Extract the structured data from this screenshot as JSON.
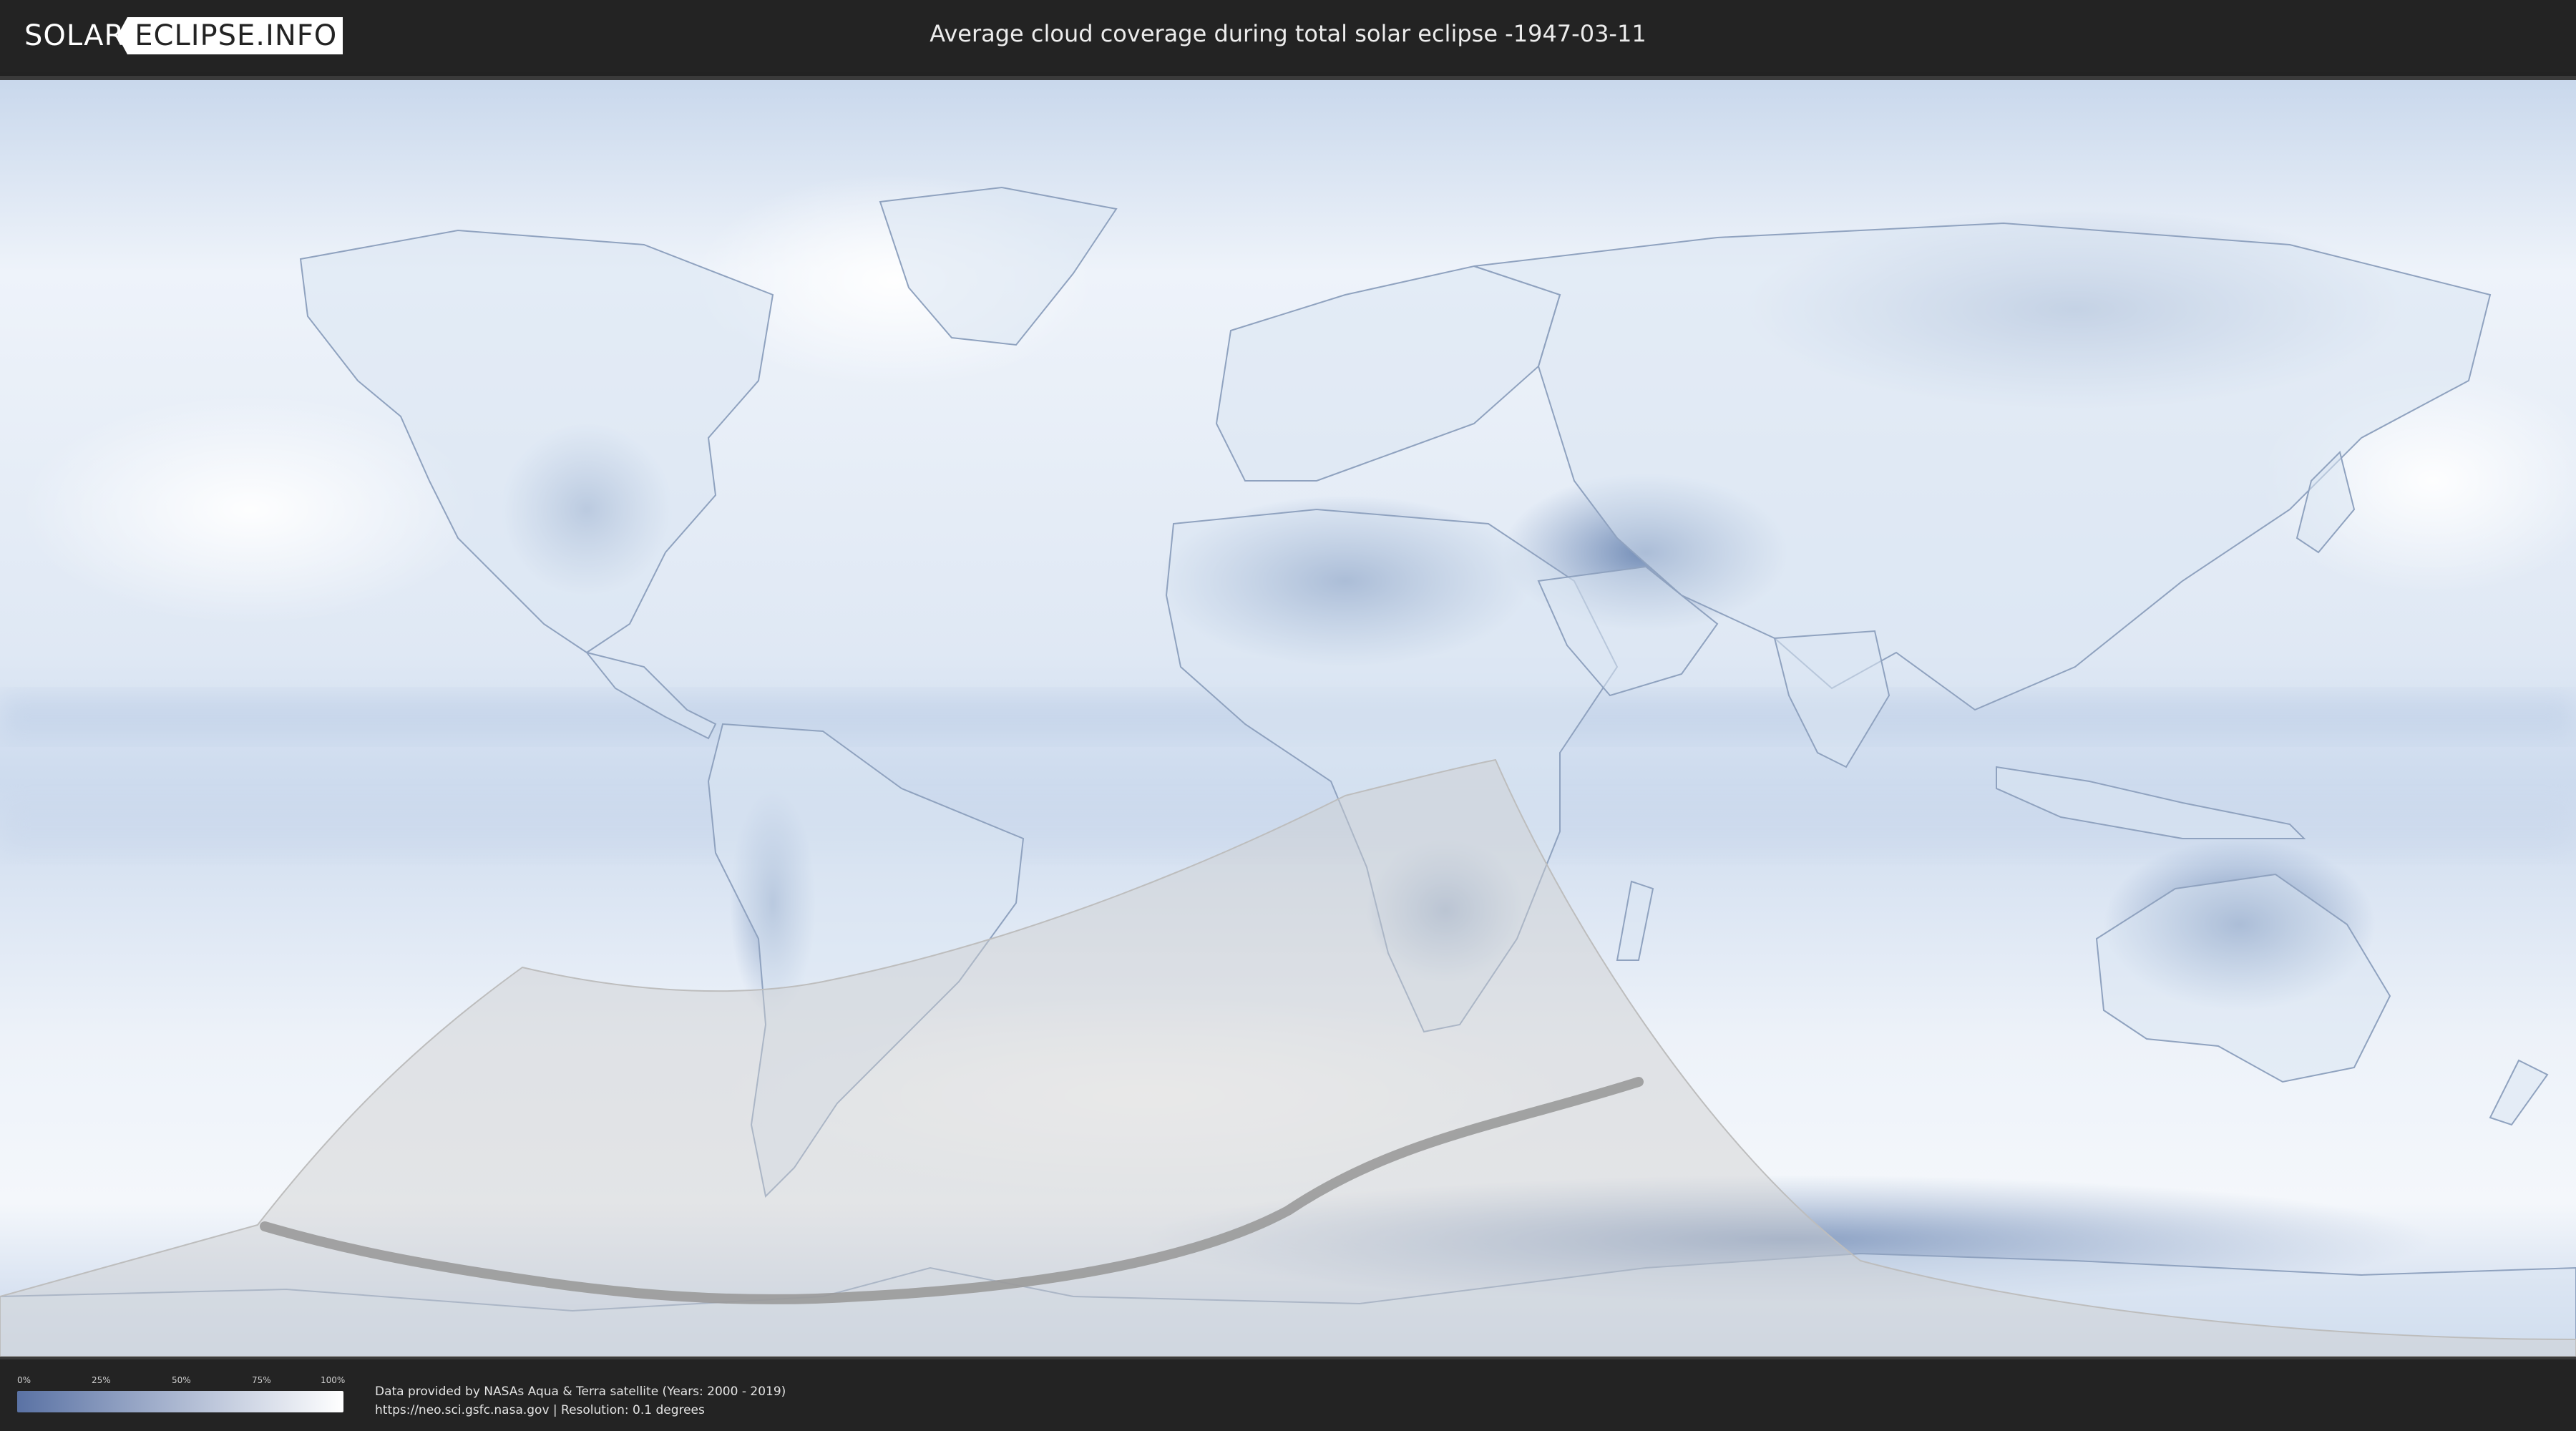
{
  "header": {
    "logo_left": "SOLAR",
    "logo_right": "ECLIPSE.INFO",
    "title": "Average cloud coverage during total solar eclipse -1947-03-11"
  },
  "map": {
    "colors": {
      "ocean_cloud": "#e6eef8",
      "clear_sky": "#5a78a8",
      "full_cloud": "#ffffff",
      "eclipse_shade": "#d8d8d8",
      "totality_path": "#9a9a9a",
      "border_line": "#8da0bc"
    }
  },
  "legend": {
    "ticks": [
      "0%",
      "25%",
      "50%",
      "75%",
      "100%"
    ],
    "gradient_from": "#5a72a4",
    "gradient_to": "#ffffff"
  },
  "footer": {
    "line1": "Data provided by NASAs Aqua & Terra satellite (Years: 2000 - 2019)",
    "line2": "https://neo.sci.gsfc.nasa.gov | Resolution: 0.1 degrees"
  }
}
